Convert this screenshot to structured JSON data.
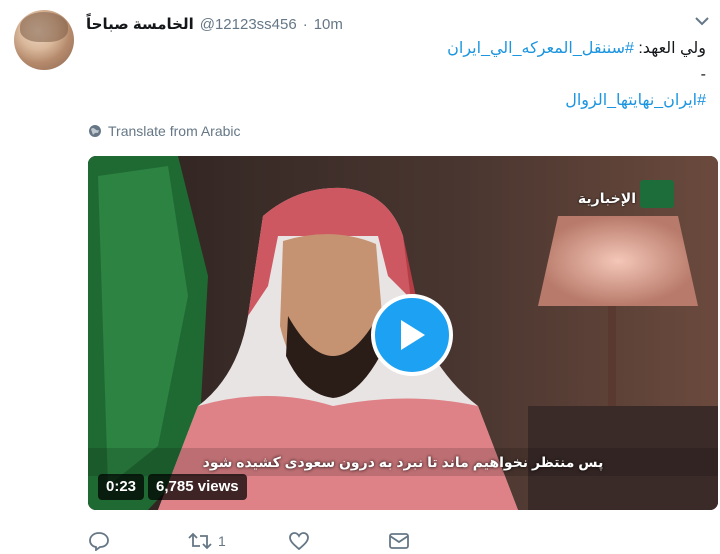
{
  "tweet": {
    "display_name": "الخامسة صباحاً",
    "handle": "@12123ss456",
    "separator": "·",
    "time": "10m",
    "text_line1_prefix": "ولي العهد: ",
    "text_line1_hashtag": "#سننقل_المعركه_الي_ايران",
    "text_line2": "-",
    "text_line3_hashtag": "#ايران_نهايتها_الزوال",
    "translate_label": "Translate from Arabic"
  },
  "video": {
    "channel_name": "الإخبارية",
    "subtitle": "پس منتظر نخواهیم ماند تا نبرد به درون سعودی کشیده شود",
    "duration": "0:23",
    "views": "6,785 views"
  },
  "actions": {
    "retweet_count": "1"
  },
  "colors": {
    "accent": "#1da1f2",
    "link": "#1b95e0",
    "muted": "#657786"
  },
  "icons": [
    "chevron-down-icon",
    "globe-icon",
    "play-icon",
    "reply-icon",
    "retweet-icon",
    "like-icon",
    "message-icon"
  ]
}
